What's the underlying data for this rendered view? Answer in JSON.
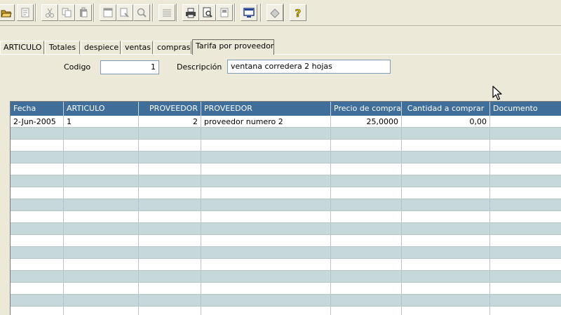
{
  "toolbar": {
    "buttons": [
      {
        "name": "open-folder-icon",
        "color": "#c89a2a"
      },
      {
        "name": "edit-document-icon",
        "color": "#9a9a9a"
      },
      {
        "name": "cut-icon",
        "color": "#9a9a9a"
      },
      {
        "name": "copy-icon",
        "color": "#9a9a9a"
      },
      {
        "name": "paste-icon",
        "color": "#9a9a9a"
      },
      {
        "name": "window-icon",
        "color": "#9a9a9a"
      },
      {
        "name": "find-replace-icon",
        "color": "#9a9a9a"
      },
      {
        "name": "search-icon",
        "color": "#9a9a9a"
      },
      {
        "name": "list-icon",
        "color": "#9a9a9a"
      },
      {
        "name": "print-icon",
        "color": "#444444"
      },
      {
        "name": "print-preview-icon",
        "color": "#444444"
      },
      {
        "name": "page-setup-icon",
        "color": "#9a9a9a"
      },
      {
        "name": "monitor-icon",
        "color": "#1f3f8f"
      },
      {
        "name": "eraser-icon",
        "color": "#8a8a8a"
      },
      {
        "name": "help-icon",
        "color": "#d4b800"
      }
    ]
  },
  "tabs": [
    {
      "label": "ARTICULO",
      "active": false
    },
    {
      "label": "Totales",
      "active": false
    },
    {
      "label": "despiece",
      "active": false
    },
    {
      "label": "ventas",
      "active": false
    },
    {
      "label": "compras",
      "active": false
    },
    {
      "label": "Tarifa por proveedor",
      "active": true
    }
  ],
  "form": {
    "codigo_label": "Codigo",
    "codigo_value": "1",
    "descripcion_label": "Descripción",
    "descripcion_value": "ventana corredera 2 hojas"
  },
  "grid": {
    "columns": [
      "Fecha",
      "ARTICULO",
      "PROVEEDOR",
      "PROVEEDOR",
      "Precio de compra",
      "Cantidad a comprar",
      "Documento"
    ],
    "rows": [
      [
        "2-Jun-2005",
        "1",
        "2",
        "proveedor numero 2",
        "25,0000",
        "0,00",
        ""
      ]
    ],
    "empty_rows": 16
  },
  "colors": {
    "header_bg": "#3e6e99",
    "row_alt": "#c7d8db",
    "window_bg": "#ece9d8"
  }
}
